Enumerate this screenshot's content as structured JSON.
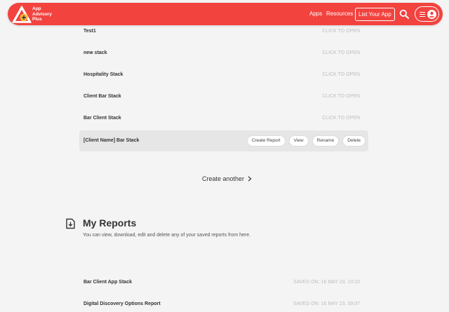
{
  "navbar": {
    "brand_line1": "App",
    "brand_line2": "Advisory",
    "brand_line3": "Plus",
    "apps": "Apps",
    "resources": "Resources",
    "list_your_app": "List Your App",
    "accent_color": "#f2433f",
    "search_icon": "search-icon",
    "menu_icon": "hamburger-icon",
    "user_icon": "user-icon"
  },
  "stacks": [
    {
      "name": "Test1",
      "action": "CLICK TO OPEN"
    },
    {
      "name": "new stack",
      "action": "CLICK TO OPEN"
    },
    {
      "name": "Hospitality Stack",
      "action": "CLICK TO OPEN"
    },
    {
      "name": "Client Bar Stack",
      "action": "CLICK TO OPEN"
    },
    {
      "name": "Bar Client Stack",
      "action": "CLICK TO OPEN"
    },
    {
      "name": "[Client Name] Bar Stack",
      "buttons": [
        "Create Report",
        "View",
        "Rename",
        "Delete"
      ]
    }
  ],
  "create_another": "Create another",
  "reports": {
    "title": "My Reports",
    "description": "You can view, download, edit and delete any of your saved reports from here.",
    "items": [
      {
        "name": "Bar Client App Stack",
        "saved": "SAVED ON: 16 MAY 23, 10:10"
      },
      {
        "name": "Digital Discovery Options Report",
        "saved": "SAVED ON: 16 MAY 23, 09:07"
      }
    ]
  }
}
